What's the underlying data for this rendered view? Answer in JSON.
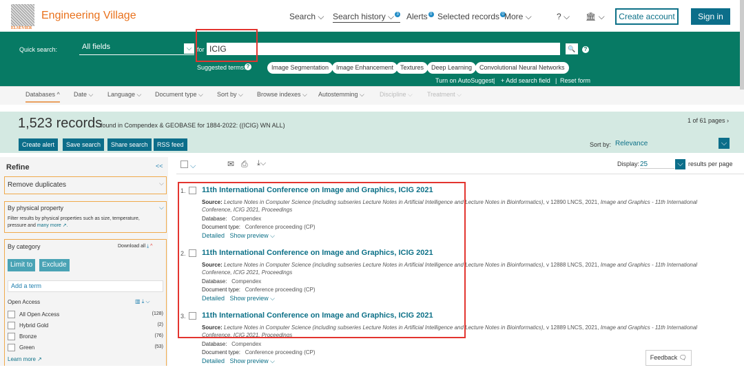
{
  "header": {
    "brand": "Engineering Village",
    "logo_text": "ELSEVIER",
    "nav": [
      {
        "label": "Search ⌵"
      },
      {
        "label": "Search history ⌵",
        "badge": "3"
      },
      {
        "label": "Alerts",
        "badge": "0"
      },
      {
        "label": "Selected records",
        "badge": "0"
      },
      {
        "label": "More ⌵"
      }
    ],
    "help": "? ⌵",
    "institution": "🏛 ⌵",
    "create_account": "Create account",
    "sign_in": "Sign in"
  },
  "search": {
    "label": "Quick search:",
    "field": "All fields",
    "for": "for",
    "value": "ICIG",
    "suggested_label": "Suggested terms:",
    "suggestions": [
      "Image Segmentation",
      "Image Enhancement",
      "Textures",
      "Deep Learning",
      "Convolutional Neural Networks"
    ],
    "autosuggest": "Turn on AutoSuggest",
    "add_field": "+ Add search field",
    "reset": "Reset form"
  },
  "filters": [
    "Databases ^",
    "Date ⌵",
    "Language ⌵",
    "Document type ⌵",
    "Sort by ⌵",
    "Browse indexes ⌵",
    "Autostemming ⌵",
    "Discipline ⌵",
    "Treatment ⌵"
  ],
  "summary": {
    "count": "1,523 records",
    "found": "found in Compendex & GEOBASE for 1884-2022: ((ICIG) WN ALL)",
    "pages": "1 of 61 pages ›",
    "actions": [
      "Create alert",
      "Save search",
      "Share search",
      "RSS feed"
    ],
    "sort_label": "Sort by:",
    "sort_value": "Relevance",
    "display_label": "Display:",
    "display_value": "25",
    "per_page": "results per page"
  },
  "refine": {
    "title": "Refine",
    "collapse": "<<",
    "remove_duplicates": "Remove duplicates",
    "physical": "By physical property",
    "physical_desc": "Filter results by physical properties such as size, temperature, pressure and",
    "many_more": "many more ↗.",
    "category": "By category",
    "download_all": "Download all",
    "limit": "Limit to",
    "exclude": "Exclude",
    "add_term": "Add a term",
    "open_access": "Open Access",
    "items": [
      {
        "label": "All Open Access",
        "count": "(128)"
      },
      {
        "label": "Hybrid Gold",
        "count": "(2)"
      },
      {
        "label": "Bronze",
        "count": "(76)"
      },
      {
        "label": "Green",
        "count": "(53)"
      }
    ],
    "learn_more": "Learn more ↗"
  },
  "results": [
    {
      "num": "1.",
      "title": "11th International Conference on Image and Graphics, ICIG 2021",
      "source_label": "Source:",
      "source": "Lecture Notes in Computer Science (including subseries Lecture Notes in Artificial Intelligence and Lecture Notes in Bioinformatics)",
      "source_vol": ", v 12890 LNCS, 2021,",
      "source_tail": "Image and Graphics - 11th International Conference, ICIG 2021, Proceedings",
      "db_label": "Database:",
      "db": "Compendex",
      "type_label": "Document type:",
      "type": "Conference proceeding (CP)",
      "detailed": "Detailed",
      "preview": "Show preview ⌵"
    },
    {
      "num": "2.",
      "title": "11th International Conference on Image and Graphics, ICIG 2021",
      "source_label": "Source:",
      "source": "Lecture Notes in Computer Science (including subseries Lecture Notes in Artificial Intelligence and Lecture Notes in Bioinformatics)",
      "source_vol": ", v 12888 LNCS, 2021,",
      "source_tail": "Image and Graphics - 11th International Conference, ICIG 2021, Proceedings",
      "db_label": "Database:",
      "db": "Compendex",
      "type_label": "Document type:",
      "type": "Conference proceeding (CP)",
      "detailed": "Detailed",
      "preview": "Show preview ⌵"
    },
    {
      "num": "3.",
      "title": "11th International Conference on Image and Graphics, ICIG 2021",
      "source_label": "Source:",
      "source": "Lecture Notes in Computer Science (including subseries Lecture Notes in Artificial Intelligence and Lecture Notes in Bioinformatics)",
      "source_vol": ", v 12889 LNCS, 2021,",
      "source_tail": "Image and Graphics - 11th International Conference, ICIG 2021, Proceedings",
      "db_label": "Database:",
      "db": "Compendex",
      "type_label": "Document type:",
      "type": "Conference proceeding (CP)",
      "detailed": "Detailed",
      "preview": "Show preview ⌵"
    }
  ],
  "feedback": "Feedback 🗨"
}
